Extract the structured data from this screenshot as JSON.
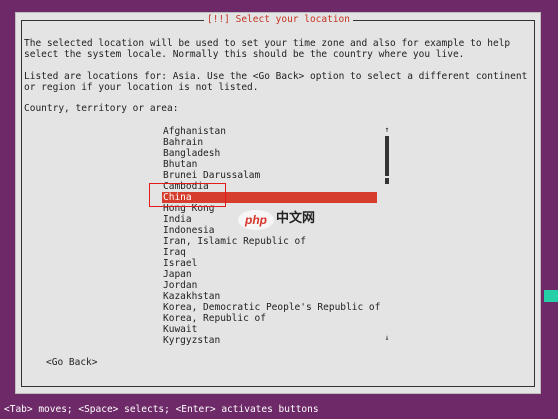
{
  "dialog": {
    "title": "[!!] Select your location",
    "intro_line1": "The selected location will be used to set your time zone and also for example to help",
    "intro_line2": "select the system locale. Normally this should be the country where you live.",
    "listed_line1": "Listed are locations for: Asia. Use the <Go Back> option to select a different continent",
    "listed_line2": "or region if your location is not listed.",
    "prompt": "Country, territory or area:",
    "back_label": "<Go Back>"
  },
  "countries": [
    "Afghanistan",
    "Bahrain",
    "Bangladesh",
    "Bhutan",
    "Brunei Darussalam",
    "Cambodia",
    "China",
    "Hong Kong",
    "India",
    "Indonesia",
    "Iran, Islamic Republic of",
    "Iraq",
    "Israel",
    "Japan",
    "Jordan",
    "Kazakhstan",
    "Korea, Democratic People's Republic of",
    "Korea, Republic of",
    "Kuwait",
    "Kyrgyzstan"
  ],
  "selected_country": "China",
  "scrollbar": {
    "up": "↑",
    "down": "↓"
  },
  "watermark": {
    "left": "php",
    "right": "中文网"
  },
  "status_bar": "<Tab> moves; <Space> selects; <Enter> activates buttons",
  "colors": {
    "background": "#6e2a68",
    "dialog": "#e4e4e4",
    "title": "#c4341f",
    "selection": "#d63d2d"
  }
}
